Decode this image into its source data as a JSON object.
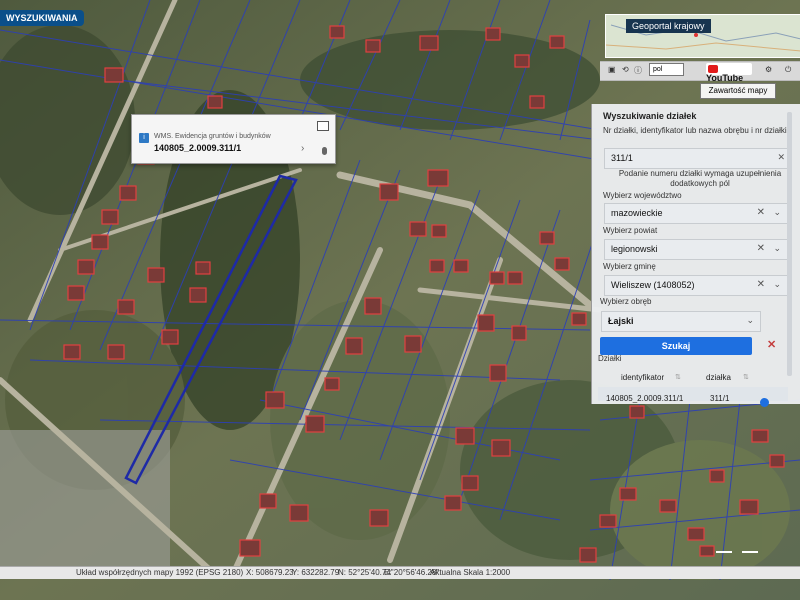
{
  "top_left_button": "WYSZUKIWANIA",
  "overview_title": "Geoportal krajowy",
  "toolbar": {
    "language": "pol",
    "youtube": "YouTube",
    "contents": "Zawartość mapy"
  },
  "popup": {
    "title": "WMS. Ewidencja gruntów i budynków",
    "value": "140805_2.0009.311/1"
  },
  "search_panel": {
    "title": "Wyszukiwanie działek",
    "query_label": "Nr działki, identyfikator lub nazwa obrębu i nr działki",
    "query_value": "311/1",
    "hint": "Podanie numeru działki wymaga uzupełnienia dodatkowych pól",
    "voivodeship_label": "Wybierz województwo",
    "voivodeship_value": "mazowieckie",
    "county_label": "Wybierz powiat",
    "county_value": "legionowski",
    "commune_label": "Wybierz gminę",
    "commune_value": "Wieliszew (1408052)",
    "precinct_label": "Wybierz obręb",
    "precinct_value": "Łajski",
    "search_button": "Szukaj",
    "results_label": "Działki",
    "col_identifier": "identyfikator",
    "col_parcel": "działka",
    "row_identifier": "140805_2.0009.311/1",
    "row_parcel": "311/1"
  },
  "status_bar": {
    "coord_system": "Układ współrzędnych mapy 1992 (EPSG 2180)",
    "x": "X: 508679.23",
    "y": "Y: 632282.79",
    "n": "N: 52°25'40.74\"",
    "e": "E: 20°56'46.28\"",
    "scale": "Aktualna Skala 1:2000"
  },
  "colors": {
    "accent": "#1e6fe0",
    "parcel_outline": "#2c3fb6",
    "building_outline": "#d23636"
  }
}
